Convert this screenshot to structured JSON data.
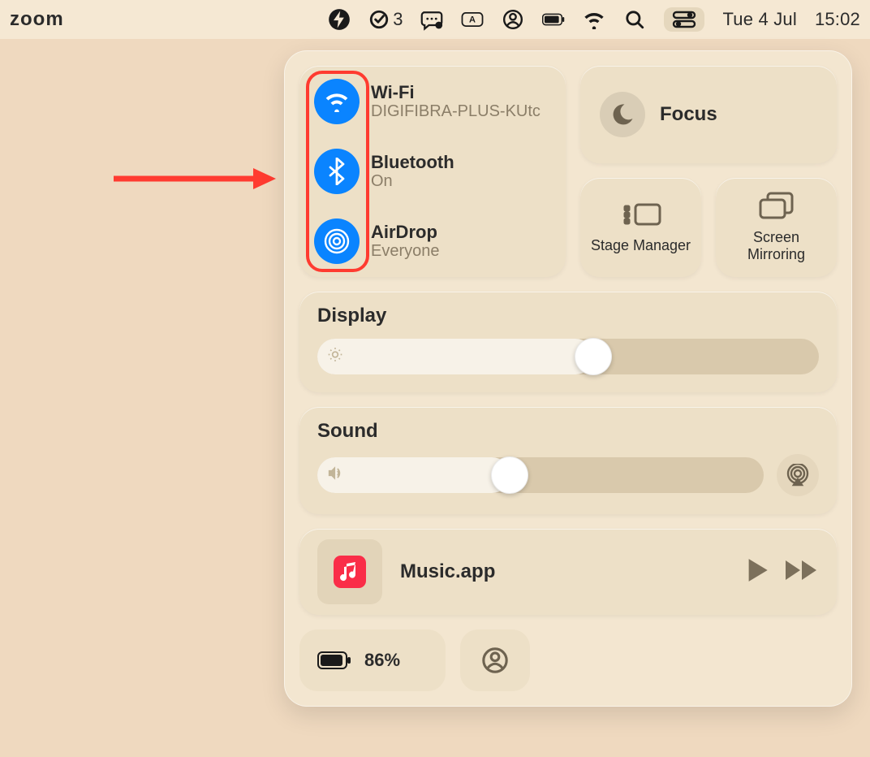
{
  "menubar": {
    "app_label": "zoom",
    "todo_count": "3",
    "date": "Tue 4 Jul",
    "time": "15:02"
  },
  "conn": {
    "wifi": {
      "title": "Wi-Fi",
      "sub": "DIGIFIBRA-PLUS-KUtc"
    },
    "bt": {
      "title": "Bluetooth",
      "sub": "On"
    },
    "airdrop": {
      "title": "AirDrop",
      "sub": "Everyone"
    }
  },
  "focus": {
    "label": "Focus"
  },
  "stage": {
    "label": "Stage Manager"
  },
  "mirror": {
    "label": "Screen Mirroring"
  },
  "display": {
    "title": "Display",
    "value_pct": 55
  },
  "sound": {
    "title": "Sound",
    "value_pct": 43
  },
  "music": {
    "name": "Music.app"
  },
  "battery": {
    "label": "86%"
  }
}
